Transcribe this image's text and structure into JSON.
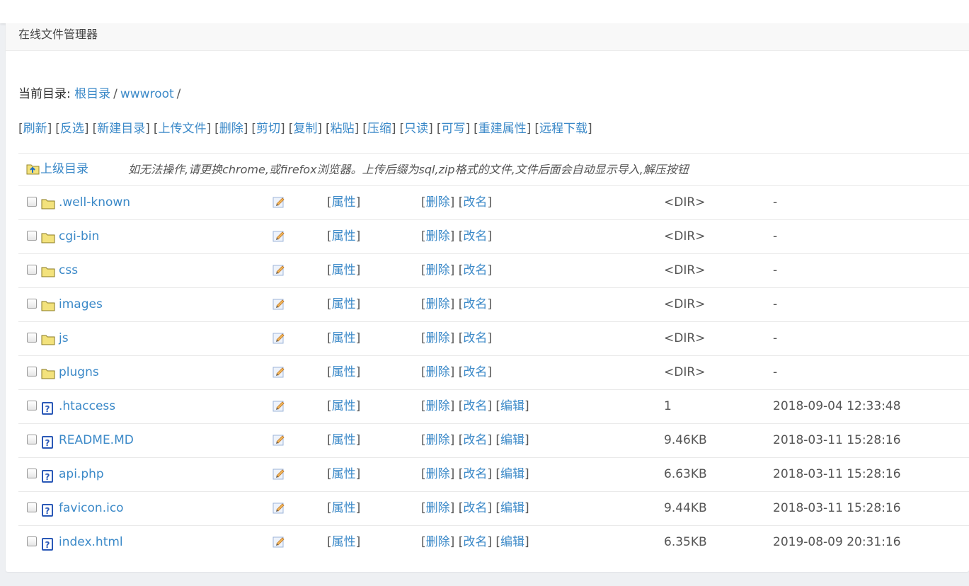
{
  "app": {
    "title": "在线文件管理器"
  },
  "breadcrumb": {
    "label": "当前目录:",
    "items": [
      "根目录",
      "wwwroot"
    ],
    "separator": "/"
  },
  "toolbar": {
    "actions": [
      "刷新",
      "反选",
      "新建目录",
      "上传文件",
      "删除",
      "剪切",
      "复制",
      "粘贴",
      "压缩",
      "只读",
      "可写",
      "重建属性",
      "远程下载"
    ]
  },
  "list": {
    "parent_label": "上级目录",
    "hint": "如无法操作,请更换chrome,或firefox浏览器。上传后缀为sql,zip格式的文件,文件后面会自动显示导入,解压按钮",
    "labels": {
      "props": "属性",
      "delete": "删除",
      "rename": "改名",
      "edit": "编辑"
    },
    "rows": [
      {
        "name": ".well-known",
        "type": "dir",
        "size": "<DIR>",
        "mtime": "-"
      },
      {
        "name": "cgi-bin",
        "type": "dir",
        "size": "<DIR>",
        "mtime": "-"
      },
      {
        "name": "css",
        "type": "dir",
        "size": "<DIR>",
        "mtime": "-"
      },
      {
        "name": "images",
        "type": "dir",
        "size": "<DIR>",
        "mtime": "-"
      },
      {
        "name": "js",
        "type": "dir",
        "size": "<DIR>",
        "mtime": "-"
      },
      {
        "name": "plugns",
        "type": "dir",
        "size": "<DIR>",
        "mtime": "-"
      },
      {
        "name": ".htaccess",
        "type": "file",
        "size": "1",
        "mtime": "2018-09-04 12:33:48"
      },
      {
        "name": "README.MD",
        "type": "file",
        "size": "9.46KB",
        "mtime": "2018-03-11 15:28:16"
      },
      {
        "name": "api.php",
        "type": "file",
        "size": "6.63KB",
        "mtime": "2018-03-11 15:28:16"
      },
      {
        "name": "favicon.ico",
        "type": "file",
        "size": "9.44KB",
        "mtime": "2018-03-11 15:28:16"
      },
      {
        "name": "index.html",
        "type": "file",
        "size": "6.35KB",
        "mtime": "2019-08-09 20:31:16"
      }
    ]
  },
  "colors": {
    "link": "#3b89c8",
    "text": "#333333",
    "border": "#eaeaea",
    "folder": "#f3e27c",
    "file_icon": "#2b59b7"
  },
  "icons": {
    "folder": "folder-icon",
    "file": "unknown-file-icon",
    "parent": "parent-folder-icon",
    "edit": "pencil-edit-icon"
  }
}
